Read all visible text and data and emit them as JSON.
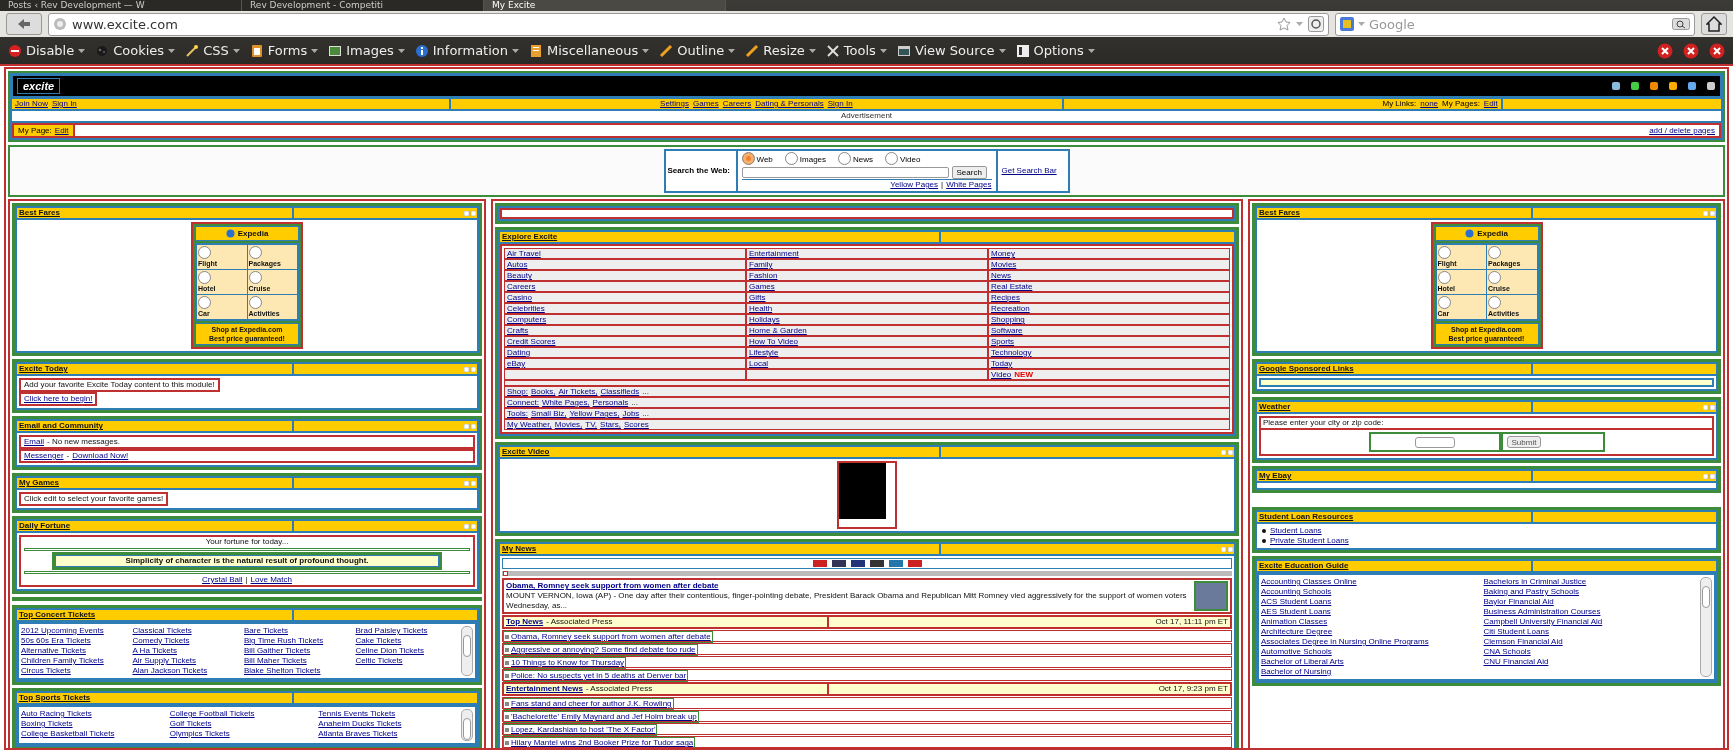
{
  "browser": {
    "tabs": [
      {
        "label": "Posts ‹ Rev Development — W",
        "selected": false
      },
      {
        "label": "Rev Development - Competiti",
        "selected": false
      },
      {
        "label": "My Excite",
        "selected": true
      }
    ],
    "address": "www.excite.com",
    "search_placeholder": "Google"
  },
  "dev_toolbar": {
    "menus": [
      "Disable",
      "Cookies",
      "CSS",
      "Forms",
      "Images",
      "Information",
      "Miscellaneous",
      "Outline",
      "Resize",
      "Tools",
      "View Source",
      "Options"
    ]
  },
  "header": {
    "logo": "excite",
    "nav_left": [
      "Join Now",
      "Sign In"
    ],
    "nav_center": [
      "Settings",
      "Games",
      "Careers",
      "Dating & Personals",
      "Sign In"
    ],
    "nav_right": [
      {
        "label": "My Links:",
        "link": "none"
      },
      {
        "label": "My Pages:",
        "link": "Edit"
      }
    ],
    "advertisement": "Advertisement",
    "my_page": {
      "label": "My Page:",
      "link": "Edit",
      "right_link": "add / delete pages"
    }
  },
  "search": {
    "label": "Search the Web:",
    "options": [
      {
        "label": "Web",
        "selected": true
      },
      {
        "label": "Images",
        "selected": false
      },
      {
        "label": "News",
        "selected": false
      },
      {
        "label": "Video",
        "selected": false
      }
    ],
    "button": "Search",
    "links": [
      "Yellow Pages",
      "White Pages"
    ],
    "link_separator": "|",
    "side_link": "Get Search Bar"
  },
  "columns": [
    [
      {
        "title": "Best Fares",
        "kind": "expedia",
        "controls": true,
        "brand": "Expedia",
        "options": [
          {
            "label": "Flight",
            "selected": false
          },
          {
            "label": "Packages",
            "selected": false
          },
          {
            "label": "Hotel",
            "selected": false
          },
          {
            "label": "Cruise",
            "selected": false
          },
          {
            "label": "Car",
            "selected": false
          },
          {
            "label": "Activities",
            "selected": false
          }
        ],
        "promo": [
          "Shop at Expedia.com",
          "Best price guaranteed!"
        ]
      },
      {
        "title": "Excite Today",
        "kind": "notes",
        "controls": true,
        "wide": false,
        "lines": [
          [
            {
              "text": "Add your favorite Excite Today content to this module!",
              "link": false
            }
          ],
          [
            {
              "text": "Click here to begin!",
              "link": true
            }
          ]
        ]
      },
      {
        "title": "Email and Community",
        "kind": "notes",
        "controls": true,
        "wide": true,
        "lines": [
          [
            {
              "text": "Email",
              "link": true
            },
            {
              "text": "- No new messages.",
              "link": false
            }
          ],
          [
            {
              "text": "Messenger",
              "link": true
            },
            {
              "text": "-",
              "link": false
            },
            {
              "text": "Download Now!",
              "link": true
            }
          ]
        ]
      },
      {
        "title": "My Games",
        "kind": "notes",
        "controls": true,
        "wide": false,
        "lines": [
          [
            {
              "text": "Click edit to select your favorite games!",
              "link": false
            }
          ]
        ]
      },
      {
        "title": "Daily Fortune",
        "kind": "fortune",
        "controls": true,
        "intro": "Your fortune for today...",
        "fortune": "Simplicity of character is the natural result of profound thought.",
        "links": [
          "Crystal Ball",
          "Love Match"
        ],
        "link_separator": "|"
      },
      {
        "kind": "separator"
      },
      {
        "title": "Top Concert Tickets",
        "kind": "list",
        "controls": false,
        "items": [
          "2012 Upcoming Events",
          "50s 60s Era Tickets",
          "Alternative Tickets",
          "Children Family Tickets",
          "Circus Tickets",
          "Classical Tickets",
          "Comedy Tickets",
          "A Ha Tickets",
          "Air Supply Tickets",
          "Alan Jackson Tickets",
          "Bare Tickets",
          "Big Time Rush Tickets",
          "Bill Gaither Tickets",
          "Bill Maher Tickets",
          "Blake Shelton Tickets",
          "Brad Paisley Tickets",
          "Cake Tickets",
          "Celine Dion Tickets",
          "Celtic Tickets"
        ]
      },
      {
        "title": "Top Sports Tickets",
        "kind": "list",
        "controls": false,
        "items": [
          "Auto Racing Tickets",
          "Boxing Tickets",
          "College Basketball Tickets",
          "College Football Tickets",
          "Golf Tickets",
          "Olympics Tickets",
          "Tennis Events Tickets",
          "Anaheim Ducks Tickets",
          "Atlanta Braves Tickets"
        ]
      }
    ],
    [
      {
        "kind": "blank"
      },
      {
        "title": "Explore Excite",
        "kind": "explore",
        "controls": false,
        "columns": [
          [
            {
              "label": "Air Travel"
            },
            {
              "label": "Autos"
            },
            {
              "label": "Beauty"
            },
            {
              "label": "Careers"
            },
            {
              "label": "Casino"
            },
            {
              "label": "Celebrities"
            },
            {
              "label": "Computers"
            },
            {
              "label": "Crafts"
            },
            {
              "label": "Credit Scores"
            },
            {
              "label": "Dating"
            },
            {
              "label": "eBay"
            }
          ],
          [
            {
              "label": "Entertainment"
            },
            {
              "label": "Family"
            },
            {
              "label": "Fashion"
            },
            {
              "label": "Games"
            },
            {
              "label": "Gifts"
            },
            {
              "label": "Health"
            },
            {
              "label": "Holidays"
            },
            {
              "label": "Home & Garden"
            },
            {
              "label": "How To Video"
            },
            {
              "label": "Lifestyle"
            },
            {
              "label": "Local"
            }
          ],
          [
            {
              "label": "Money"
            },
            {
              "label": "Movies"
            },
            {
              "label": "News"
            },
            {
              "label": "Real Estate"
            },
            {
              "label": "Recipes"
            },
            {
              "label": "Recreation"
            },
            {
              "label": "Shopping"
            },
            {
              "label": "Software"
            },
            {
              "label": "Sports"
            },
            {
              "label": "Technology"
            },
            {
              "label": "Today"
            },
            {
              "label": "Video",
              "badge": "NEW"
            }
          ]
        ],
        "footer": [
          [
            {
              "text": "Shop:",
              "link": true
            },
            {
              "text": "Books,",
              "link": true
            },
            {
              "text": "Air Tickets,",
              "link": true
            },
            {
              "text": "Classifieds",
              "link": true
            },
            {
              "text": "...",
              "link": false
            }
          ],
          [
            {
              "text": "Connect:",
              "link": true
            },
            {
              "text": "White Pages,",
              "link": true
            },
            {
              "text": "Personals",
              "link": true
            },
            {
              "text": "...",
              "link": false
            }
          ],
          [
            {
              "text": "Tools:",
              "link": true
            },
            {
              "text": "Small Biz,",
              "link": true
            },
            {
              "text": "Yellow Pages,",
              "link": true
            },
            {
              "text": "Jobs",
              "link": true
            },
            {
              "text": "...",
              "link": false
            }
          ],
          [
            {
              "text": "My Weather,",
              "link": true
            },
            {
              "text": "Movies,",
              "link": true
            },
            {
              "text": "TV,",
              "link": true
            },
            {
              "text": "Stars,",
              "link": true
            },
            {
              "text": "Scores",
              "link": true
            }
          ]
        ]
      },
      {
        "title": "Excite Video",
        "kind": "video",
        "controls": true
      },
      {
        "title": "My News",
        "kind": "news",
        "controls": true,
        "lead": {
          "headline": "Obama, Romney seek support from women after debate",
          "summary": "MOUNT VERNON, Iowa (AP) - One day after their contentious, finger-pointing debate, President Barack Obama and Republican Mitt Romney vied aggressively for the support of women voters Wednesday, as..."
        },
        "sections": [
          {
            "name": "Top News",
            "source": "- Associated Press",
            "time": "Oct 17, 11:11 pm ET",
            "items": [
              "Obama, Romney seek support from women after debate",
              "Aggressive or annoying? Some find debate too rude",
              "10 Things to Know for Thursday",
              "Police: No suspects yet in 5 deaths at Denver bar"
            ]
          },
          {
            "name": "Entertainment News",
            "source": "- Associated Press",
            "time": "Oct 17, 9:23 pm ET",
            "items": [
              "Fans stand and cheer for author J.K. Rowling",
              "'Bachelorette' Emily Maynard and Jef Holm break up",
              "Lopez, Kardashian to host 'The X Factor'",
              "Hilary Mantel wins 2nd Booker Prize for Tudor saga"
            ]
          }
        ]
      }
    ],
    [
      {
        "title": "Best Fares",
        "kind": "expedia",
        "controls": true,
        "brand": "Expedia",
        "options": [
          {
            "label": "Flight",
            "selected": false
          },
          {
            "label": "Packages",
            "selected": false
          },
          {
            "label": "Hotel",
            "selected": false
          },
          {
            "label": "Cruise",
            "selected": false
          },
          {
            "label": "Car",
            "selected": false
          },
          {
            "label": "Activities",
            "selected": false
          }
        ],
        "promo": [
          "Shop at Expedia.com",
          "Best price guaranteed!"
        ]
      },
      {
        "title": "Google Sponsored Links",
        "kind": "sponsored",
        "controls": false
      },
      {
        "title": "Weather",
        "kind": "weather",
        "controls": true,
        "prompt": "Please enter your city or zip code:",
        "button": "Submit"
      },
      {
        "title": "My Ebay",
        "kind": "blank",
        "controls": true
      },
      {
        "kind": "spacer"
      },
      {
        "title": "Student Loan Resources",
        "kind": "bullets",
        "controls": false,
        "items": [
          "Student Loans",
          "Private Student Loans"
        ]
      },
      {
        "title": "Excite Education Guide",
        "kind": "list",
        "controls": false,
        "items": [
          "Accounting Classes Online",
          "Accounting Schools",
          "ACS Student Loans",
          "AES Student Loans",
          "Animation Classes",
          "Architecture Degree",
          "Associates Degree in Nursing Online Programs",
          "Automotive Schools",
          "Bachelor of Liberal Arts",
          "Bachelor of Nursing",
          "Bachelors in Criminal Justice",
          "Baking and Pastry Schools",
          "Baylor Financial Aid",
          "Business Administration Courses",
          "Campbell University Financial Aid",
          "Citi Student Loans",
          "Clemson Financial Aid",
          "CNA Schools",
          "CNU Financial Aid"
        ]
      }
    ]
  ]
}
